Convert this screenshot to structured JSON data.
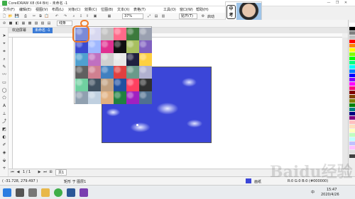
{
  "window": {
    "title": "CorelDRAW X8 (64 Bit) - 未命名 -1",
    "buttons": [
      "—",
      "❐",
      "✕"
    ]
  },
  "menu": [
    "文件(F)",
    "编辑(E)",
    "视图(V)",
    "布局(L)",
    "对象(C)",
    "效果(C)",
    "位图(B)",
    "文本(X)",
    "表格(T)",
    "工具(O)",
    "窗口(W)",
    "帮助(H)"
  ],
  "toolbar": {
    "zoom": "37%",
    "snap": "贴齐(T)",
    "launch": "启动"
  },
  "avatar": {
    "badge": "中\n考"
  },
  "propbar": {
    "unit_combo": "线条"
  },
  "tabs": [
    {
      "label": "欢迎屏幕",
      "active": false
    },
    {
      "label": "未命名 -1",
      "active": true
    }
  ],
  "page_nav": {
    "counter": "1 / 1",
    "page_tab": "页1"
  },
  "status": {
    "coords": "( -31.728, 279.497 )",
    "layer": "矩形 于 图层1",
    "fill_label": "画纸",
    "outline": "R:0 G:0 B:0 (#000000)"
  },
  "taskbar": {
    "time": "15:47",
    "date": "2020/4/26",
    "lang": "中"
  },
  "watermark": "Baidu经验",
  "colors": {
    "accent_ring": "#f07c2a",
    "page_fill": "#3b46d8"
  },
  "palette_colors": [
    "#ffffff",
    "#000000",
    "#808080",
    "#c0c0c0",
    "#ff0000",
    "#ff8000",
    "#ffff00",
    "#80ff00",
    "#00ff00",
    "#00ff80",
    "#00ffff",
    "#0080ff",
    "#0000ff",
    "#8000ff",
    "#ff00ff",
    "#ff0080",
    "#800000",
    "#804000",
    "#808000",
    "#008000",
    "#008080",
    "#000080",
    "#800080",
    "#ffc0c0",
    "#ffe0c0",
    "#ffffc0",
    "#c0ffc0",
    "#c0ffff",
    "#c0c0ff",
    "#ffc0ff",
    "#e0e0e0",
    "#404040"
  ],
  "texture_swatches": [
    "#7a8ad8",
    "#d8d8f0",
    "#c0c0c0",
    "#ff6a8a",
    "#3c7a3c",
    "#9aa0b0",
    "#3a4ad0",
    "#a0b8ff",
    "#e03090",
    "#101010",
    "#a8c060",
    "#8060c0",
    "#50a0d0",
    "#c070c0",
    "#d0d0d0",
    "#e8e8e8",
    "#202040",
    "#ffd040",
    "#606060",
    "#d08090",
    "#4080c0",
    "#e04040",
    "#6a9a8a",
    "#b0b0d0",
    "#70d0a0",
    "#405060",
    "#c0a080",
    "#2050a0",
    "#ff4060",
    "#303030",
    "#90a0b0",
    "#c0d0e0",
    "#e0b080",
    "#208040",
    "#a020c0",
    "#507090"
  ]
}
